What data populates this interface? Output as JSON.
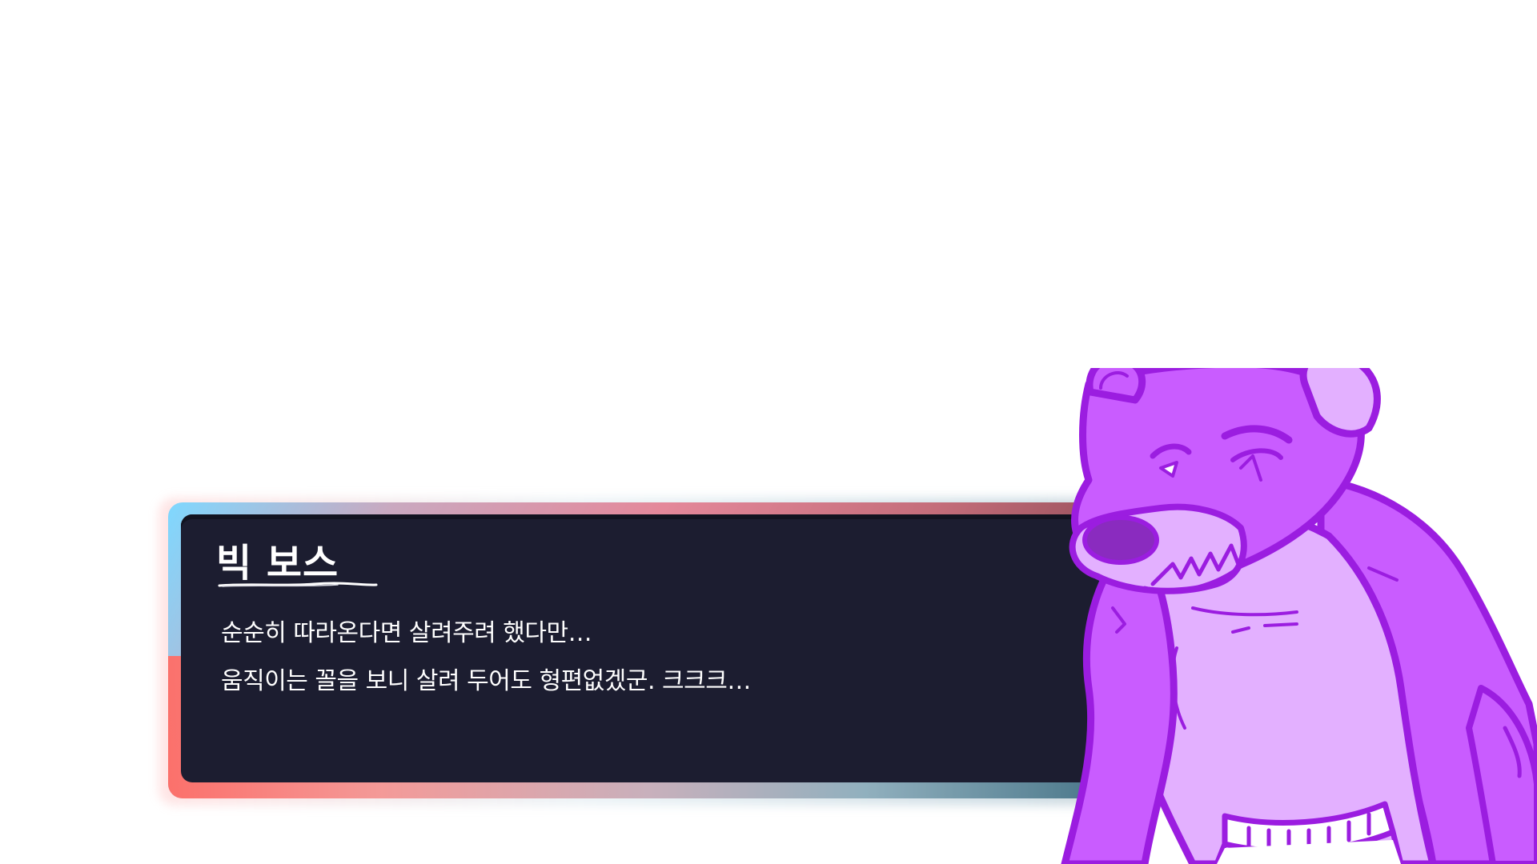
{
  "dialog": {
    "speaker": "빅 보스",
    "lines": [
      "순순히 따라온다면 살려주려 했다만…",
      "움직이는 꼴을 보니 살려 두어도 형편없겠군. 크크크…"
    ]
  },
  "character": {
    "icon": "purple-bear-boss-portrait",
    "colors": {
      "outline": "#9b1de0",
      "body": "#c95cff",
      "light": "#e3b0ff",
      "nose": "#8a2bbf"
    }
  },
  "theme": {
    "panel": "#1c1d30",
    "frame_start": "#7fd8ff",
    "frame_mid": "#e4889a",
    "frame_end": "#2e5464",
    "text": "#ffffff"
  }
}
